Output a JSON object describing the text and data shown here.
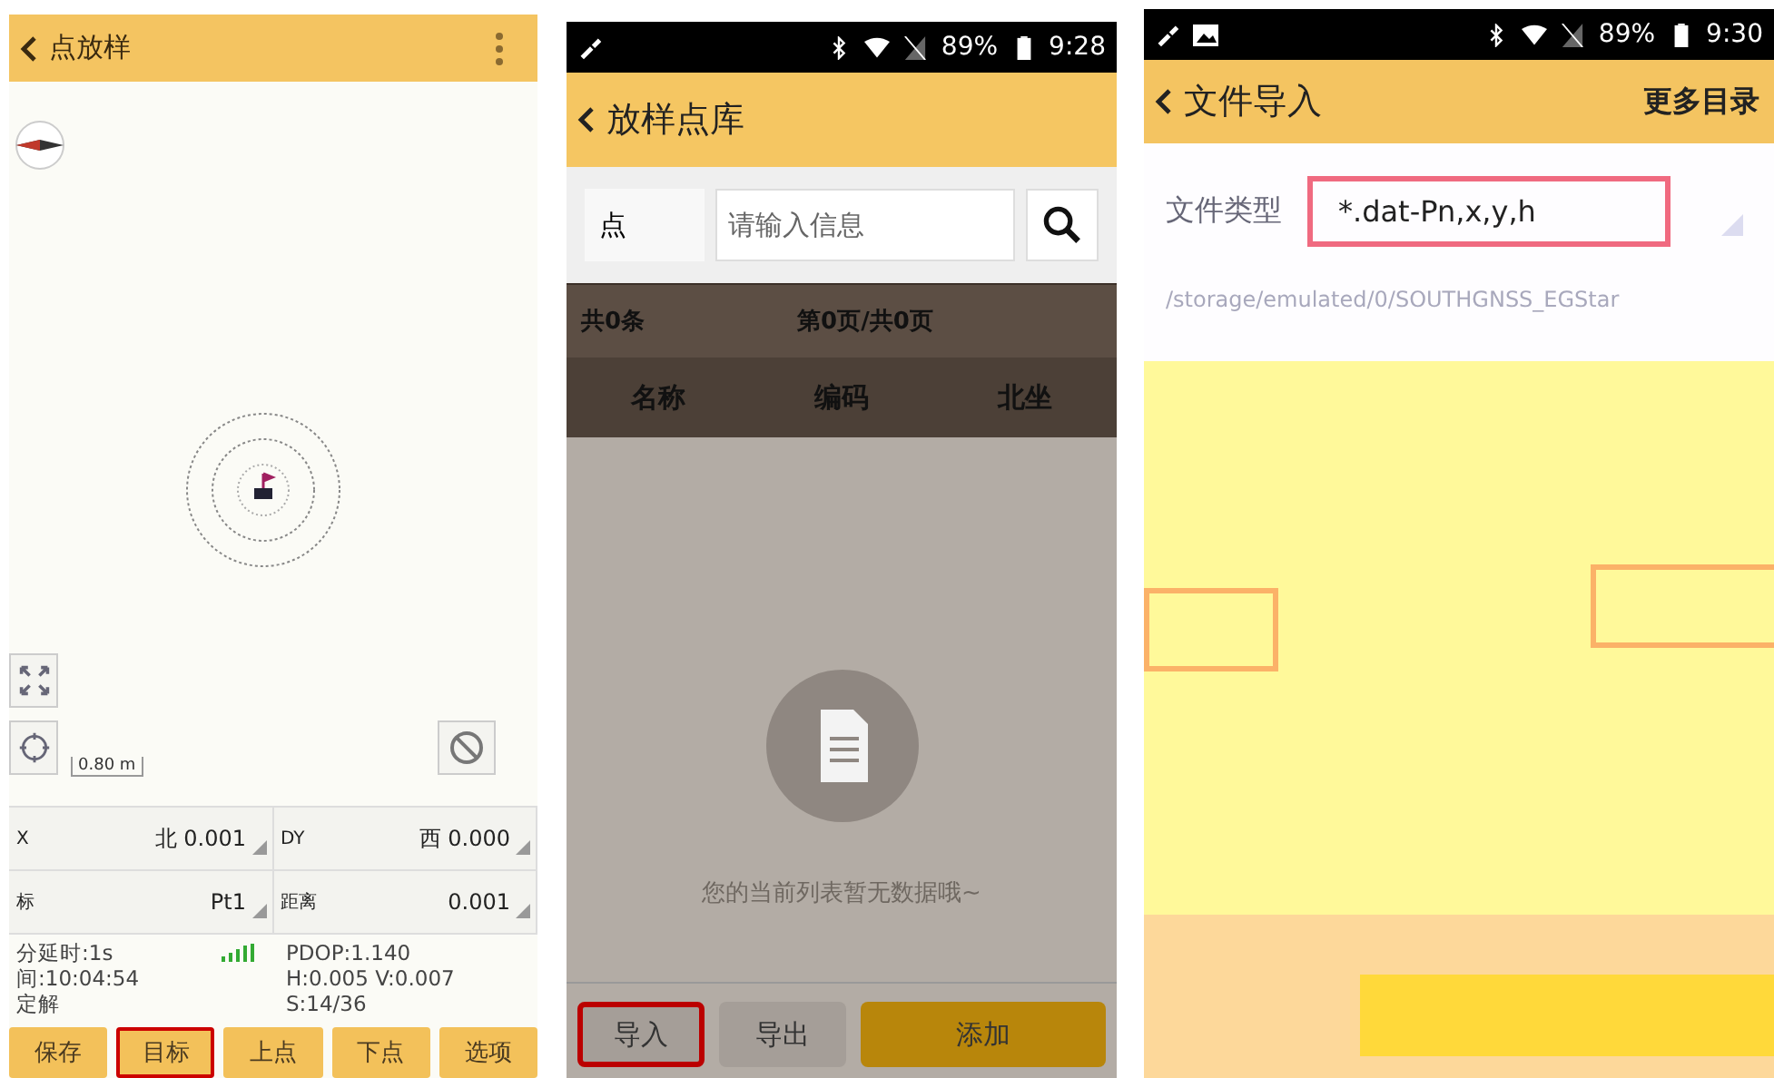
{
  "screens": [
    {
      "kind": "stakeout",
      "title": "点放样",
      "scale": "0.80 m",
      "cells": [
        {
          "label": "X",
          "value": "北 0.001"
        },
        {
          "label": "DY",
          "value": "西 0.000"
        },
        {
          "label": "标",
          "value": "Pt1"
        },
        {
          "label": "距离",
          "value": "0.001"
        }
      ],
      "status_left": [
        "分延时:1s",
        "间:10:04:54",
        "定解"
      ],
      "status_right": [
        "PDOP:1.140",
        "H:0.005 V:0.007",
        "S:14/36"
      ],
      "buttons": [
        {
          "label": "保存",
          "selected": false
        },
        {
          "label": "目标",
          "selected": true
        },
        {
          "label": "上点",
          "selected": false
        },
        {
          "label": "下点",
          "selected": false
        },
        {
          "label": "选项",
          "selected": false
        }
      ]
    },
    {
      "kind": "library",
      "battery": "89%",
      "time": "9:28",
      "title": "放样点库",
      "search_label": "点",
      "search": {
        "placeholder": "请输入信息"
      },
      "count": "共0条",
      "page": "第0页/共0页",
      "columns": [
        "名称",
        "编码",
        "北坐"
      ],
      "empty": "您的当前列表暂无数据哦~",
      "buttons": [
        {
          "label": "导入",
          "selected": true
        },
        {
          "label": "导出",
          "selected": false
        },
        {
          "label": "添加",
          "selected": false
        }
      ]
    },
    {
      "kind": "import",
      "battery": "89%",
      "time": "9:30",
      "title": "文件导入",
      "action": "更多目录",
      "field_label": "文件类型",
      "file_type": "*.dat-Pn,x,y,h",
      "path": "/storage/emulated/0/SOUTHGNSS_EGStar"
    }
  ]
}
